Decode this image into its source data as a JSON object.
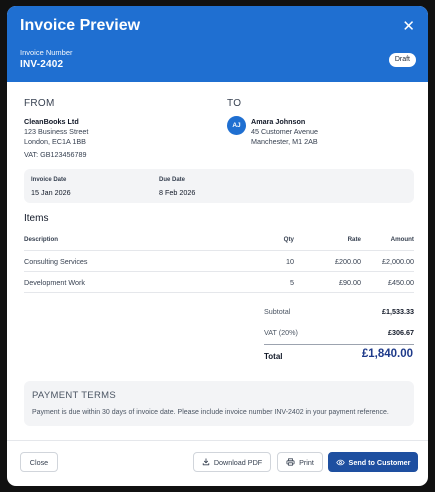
{
  "header": {
    "title": "Invoice Preview",
    "invoice_number_label": "Invoice Number",
    "invoice_number": "INV-2402",
    "status_badge": "Draft",
    "close_icon": "close-icon"
  },
  "from": {
    "label": "FROM",
    "company": "CleanBooks Ltd",
    "address_line1": "123 Business Street",
    "address_line2": "London, EC1A 1BB",
    "vat": "VAT: GB123456789"
  },
  "to": {
    "label": "TO",
    "initials": "AJ",
    "name": "Amara Johnson",
    "address_line1": "45 Customer Avenue",
    "address_line2": "Manchester, M1 2AB"
  },
  "dates": {
    "invoice_date_label": "Invoice Date",
    "invoice_date": "15 Jan 2026",
    "due_date_label": "Due Date",
    "due_date": "8 Feb 2026"
  },
  "items": {
    "title": "Items",
    "headers": {
      "description": "Description",
      "qty": "Qty",
      "rate": "Rate",
      "amount": "Amount"
    },
    "rows": [
      {
        "description": "Consulting Services",
        "qty": "10",
        "rate": "£200.00",
        "amount": "£2,000.00"
      },
      {
        "description": "Development Work",
        "qty": "5",
        "rate": "£90.00",
        "amount": "£450.00"
      }
    ]
  },
  "summary": {
    "subtotal_label": "Subtotal",
    "subtotal": "£1,533.33",
    "vat_label": "VAT (20%)",
    "vat": "£306.67",
    "total_label": "Total",
    "total": "£1,840.00"
  },
  "terms": {
    "title": "PAYMENT TERMS",
    "text": "Payment is due within 30 days of invoice date. Please include invoice number INV-2402 in your payment reference."
  },
  "footer": {
    "close_label": "Close",
    "download_label": "Download PDF",
    "print_label": "Print",
    "send_label": "Send to Customer"
  },
  "colors": {
    "header_blue": "#1f6fd1",
    "primary_button": "#1e4fa0",
    "total_text": "#1e3a8a"
  }
}
